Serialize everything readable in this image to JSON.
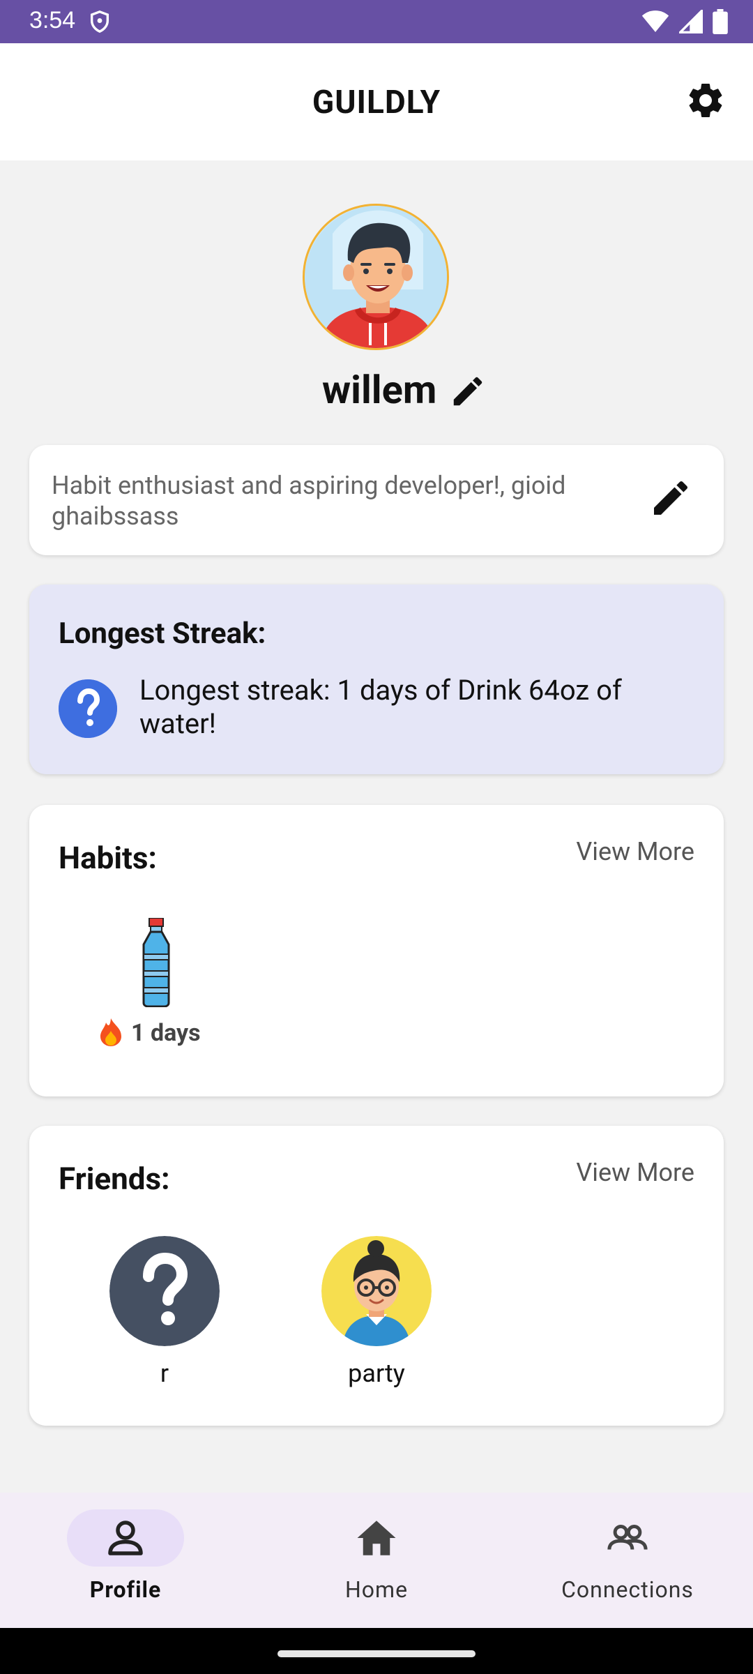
{
  "status_bar": {
    "time": "3:54"
  },
  "app_bar": {
    "title": "GUILDLY"
  },
  "profile": {
    "username": "willem",
    "bio": "Habit enthusiast and aspiring developer!, gioid ghaibssass"
  },
  "streak": {
    "title": "Longest Streak:",
    "text": "Longest streak: 1 days of Drink 64oz of water!"
  },
  "habits": {
    "title": "Habits:",
    "view_more": "View More",
    "items": [
      {
        "icon": "water-bottle-icon",
        "streak": "1 days"
      }
    ]
  },
  "friends": {
    "title": "Friends:",
    "view_more": "View More",
    "items": [
      {
        "name": "r",
        "avatar": "unknown-avatar"
      },
      {
        "name": "party",
        "avatar": "girl-with-glasses-avatar"
      }
    ]
  },
  "bottom_nav": {
    "items": [
      {
        "label": "Profile",
        "icon": "person-icon",
        "active": true
      },
      {
        "label": "Home",
        "icon": "home-icon",
        "active": false
      },
      {
        "label": "Connections",
        "icon": "people-icon",
        "active": false
      }
    ]
  },
  "colors": {
    "status_bar": "#6750a4",
    "streak_card": "#e5e6f7",
    "streak_icon": "#3e6ee0",
    "nav_background": "#f3edf7",
    "nav_active_pill": "#e8def8"
  }
}
